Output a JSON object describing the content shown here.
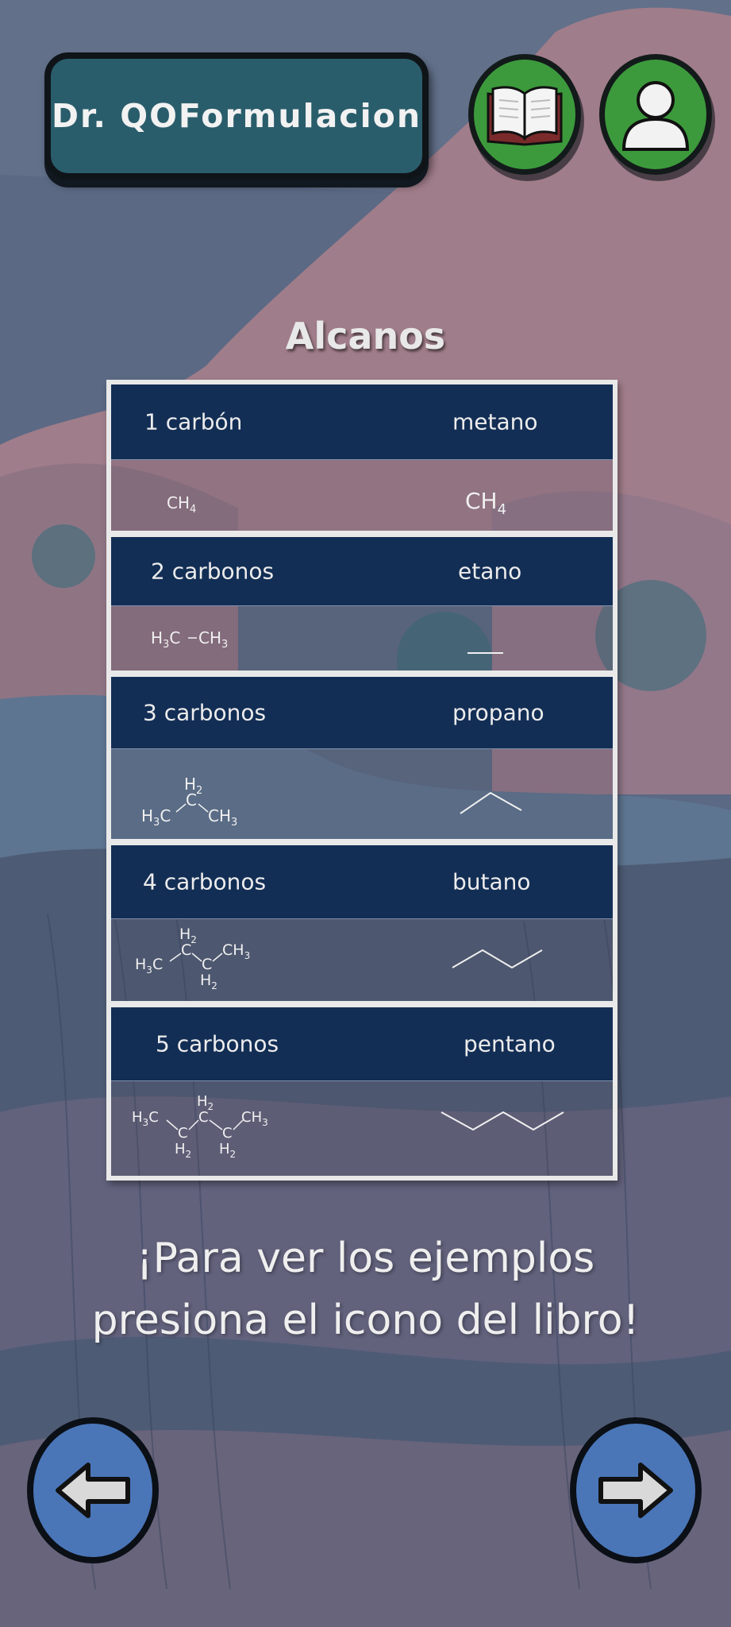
{
  "header": {
    "app_title": "Dr. QOFormulacion",
    "book_icon": "open-book-icon",
    "profile_icon": "user-profile-icon"
  },
  "section_title": "Alcanos",
  "rows": [
    {
      "carbons": "1 carbón",
      "name": "metano",
      "condensed_formula": "CH4",
      "skeletal_formula": "CH4"
    },
    {
      "carbons": "2 carbonos",
      "name": "etano",
      "condensed_formula": "H3C–CH3",
      "skeletal_formula": "line"
    },
    {
      "carbons": "3 carbonos",
      "name": "propano",
      "condensed_formula": "H3C–CH2–CH3",
      "skeletal_formula": "zigzag-3"
    },
    {
      "carbons": "4 carbonos",
      "name": "butano",
      "condensed_formula": "H3C–CH2–CH2–CH3",
      "skeletal_formula": "zigzag-4"
    },
    {
      "carbons": "5 carbonos",
      "name": "pentano",
      "condensed_formula": "H3C–CH2–CH2–CH2–CH3",
      "skeletal_formula": "zigzag-5"
    }
  ],
  "message": "¡Para ver los ejemplos presiona el icono del libro!",
  "navigation": {
    "prev_icon": "arrow-left-icon",
    "next_icon": "arrow-right-icon"
  },
  "colors": {
    "header_row": "#132e55",
    "title_box": "#2a5d6b",
    "green_button": "#3c9a3c",
    "nav_button": "#4a76b8"
  }
}
